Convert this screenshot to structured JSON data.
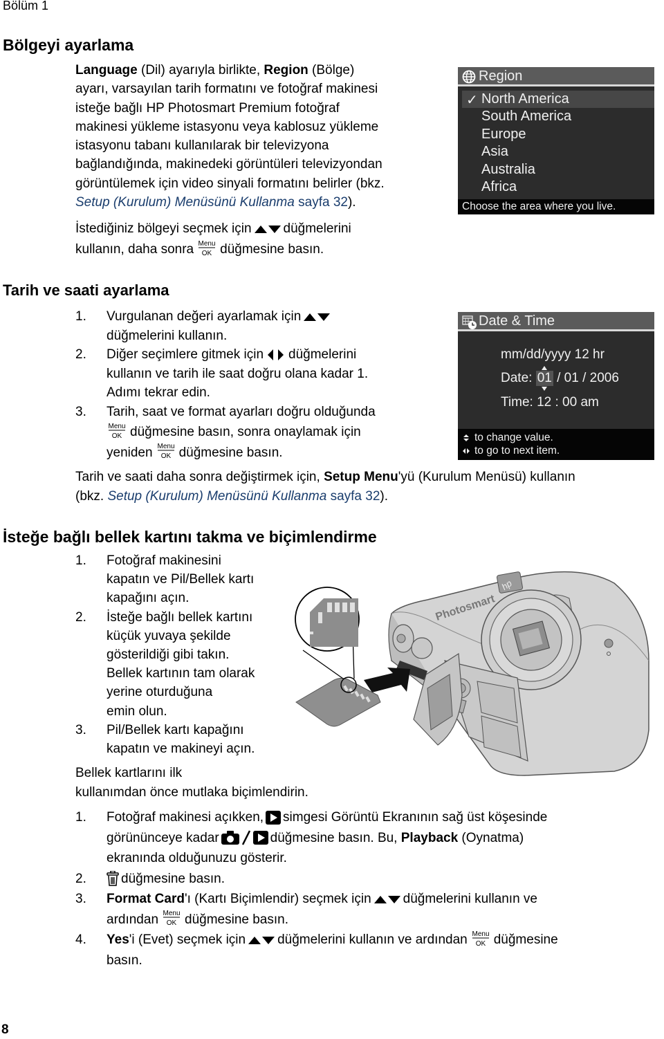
{
  "header": {
    "chapter": "Bölüm 1"
  },
  "region_section": {
    "title": "Bölgeyi ayarlama",
    "para_lines": [
      {
        "b1": "Language",
        "t1": " (Dil) ayarıyla birlikte, ",
        "b2": "Region",
        "t2": " (Bölge)"
      },
      "ayarı, varsayılan tarih formatını ve fotoğraf makinesi",
      "isteğe bağlı HP Photosmart Premium fotoğraf",
      "makinesi yükleme istasyonu veya kablosuz yükleme",
      "istasyonu tabanı kullanılarak bir televizyona",
      "bağlandığında, makinedeki görüntüleri televizyondan",
      "görüntülemek için video sinyali formatını belirler (bkz."
    ],
    "link_text": "Setup (Kurulum) Menüsünü Kullanma",
    "link_page": " sayfa 32",
    "link_end": ").",
    "instruction_1a": "İstediğiniz bölgeyi seçmek için",
    "instruction_1b": "düğmelerini",
    "instruction_2a": "kullanın, daha sonra",
    "instruction_2b": "düğmesine basın.",
    "screen": {
      "title": "Region",
      "title_icon": "globe-icon",
      "items": [
        "North America",
        "South America",
        "Europe",
        "Asia",
        "Australia",
        "Africa"
      ],
      "selected_index": 0,
      "check_glyph": "✓",
      "footer": "Choose the area where you live."
    }
  },
  "datetime_section": {
    "title": "Tarih ve saati ayarlama",
    "steps": [
      {
        "num": "1.",
        "a": "Vurgulanan değeri ayarlamak için",
        "b": "düğmelerini kullanın."
      },
      {
        "num": "2.",
        "a": "Diğer seçimlere gitmek için",
        "b": "düğmelerini",
        "c": "kullanın ve tarih ile saat doğru olana kadar 1.",
        "d": "Adımı tekrar edin."
      },
      {
        "num": "3.",
        "a": "Tarih, saat ve format ayarları doğru olduğunda",
        "b": "düğmesine basın, sonra onaylamak için",
        "c": "yeniden",
        "d": "düğmesine basın."
      }
    ],
    "note_a": "Tarih ve saati daha sonra değiştirmek için, ",
    "note_bold": "Setup Menu",
    "note_b": "'yü (Kurulum Menüsü) kullanın",
    "note_c": "(bkz. ",
    "note_link": "Setup (Kurulum) Menüsünü Kullanma",
    "note_page": " sayfa 32",
    "note_end": ").",
    "screen": {
      "title": "Date & Time",
      "title_icon": "calendar-clock-icon",
      "format": "mm/dd/yyyy  12 hr",
      "date_label": "Date:",
      "date_month": "01",
      "date_rest": " / 01 / 2006",
      "time_label": "Time:",
      "time_value": "12 : 00  am",
      "footer_1": "to change value.",
      "footer_2": "to go to next item."
    }
  },
  "memory_section": {
    "title": "İsteğe bağlı bellek kartını takma ve biçimlendirme",
    "steps": [
      {
        "num": "1.",
        "lines": [
          "Fotoğraf makinesini",
          "kapatın ve Pil/Bellek kartı",
          "kapağını açın."
        ]
      },
      {
        "num": "2.",
        "lines": [
          "İsteğe bağlı bellek kartını",
          "küçük yuvaya şekilde",
          "gösterildiği gibi takın.",
          "Bellek kartının tam olarak",
          "yerine oturduğuna",
          "emin olun."
        ]
      },
      {
        "num": "3.",
        "lines": [
          "Pil/Bellek kartı kapağını",
          "kapatın ve makineyi açın."
        ]
      }
    ],
    "note_1": "Bellek kartlarını ilk",
    "note_2": "kullanımdan önce mutlaka biçimlendirin.",
    "illustration": {
      "brand_text": "Photosmart"
    },
    "format_steps": [
      {
        "num": "1.",
        "a": "Fotoğraf makinesi açıkken,",
        "b": "simgesi Görüntü Ekranının sağ üst köşesinde",
        "c": "görününceye kadar",
        "d": "düğmesine basın. Bu, ",
        "bold": "Playback",
        "e": " (Oynatma)",
        "f": "ekranında olduğunuzu gösterir."
      },
      {
        "num": "2.",
        "a": "düğmesine basın."
      },
      {
        "num": "3.",
        "bold": "Format Card",
        "a": "'ı (Kartı Biçimlendir) seçmek için",
        "b": "düğmelerini kullanın ve",
        "c": "ardından",
        "d": "düğmesine basın."
      },
      {
        "num": "4.",
        "bold": "Yes",
        "a": "'i (Evet) seçmek için",
        "b": "düğmelerini kullanın ve ardından",
        "c": "düğmesine",
        "d": "basın."
      }
    ]
  },
  "icons": {
    "menu_top": "Menu",
    "menu_bottom": "OK"
  },
  "footer": {
    "page_number": "8"
  },
  "colors": {
    "link": "#1a3d6d",
    "lcd_bg": "#2c2c2c",
    "lcd_title": "#5b5b5b"
  }
}
